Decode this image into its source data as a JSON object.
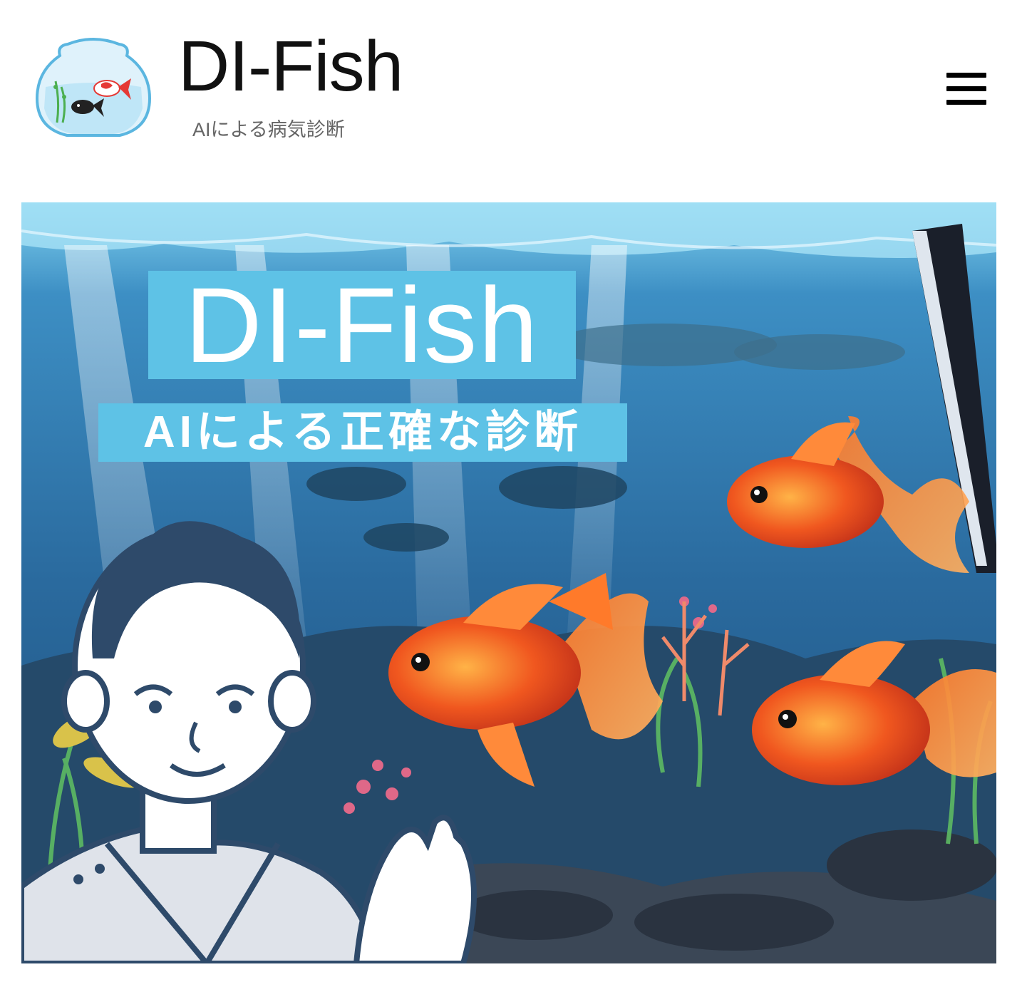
{
  "header": {
    "site_title": "DI-Fish",
    "site_subtitle": "AIによる病気診断",
    "logo_icon": "fishbowl-logo-icon",
    "menu_icon": "hamburger-menu-icon"
  },
  "hero": {
    "title": "DI-Fish",
    "tagline": "AIによる正確な診断",
    "image": "aquarium-goldfish-illustration",
    "colors": {
      "label_bg": "#5ec2e6",
      "water": "#2a6a9e",
      "goldfish": "#f0571f",
      "character_dark": "#2e4a6a"
    }
  }
}
